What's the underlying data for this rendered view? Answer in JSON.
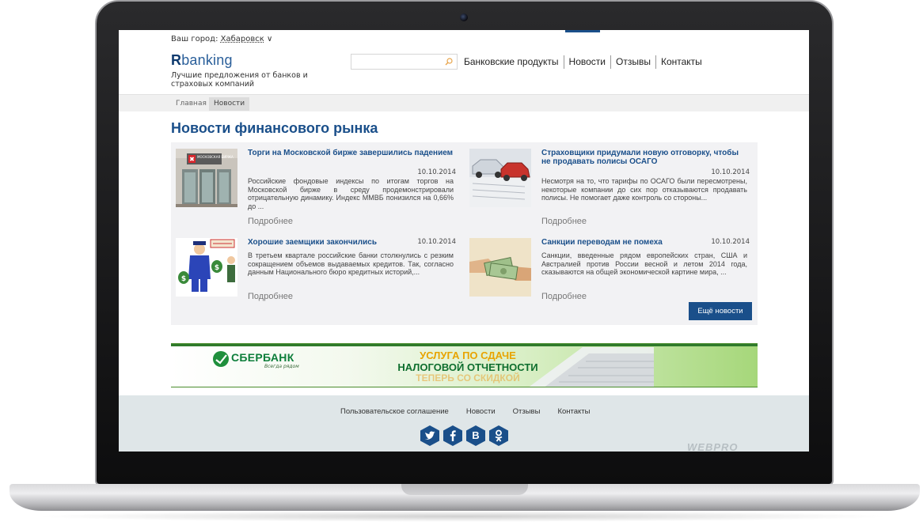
{
  "header": {
    "city_label": "Ваш город:",
    "city_name": "Хабаровск",
    "logo_r": "R",
    "logo_banking": "banking",
    "slogan": "Лучшие предложения от банков и страховых компаний",
    "search_placeholder": ""
  },
  "nav": {
    "items": [
      {
        "label": "Банковские продукты"
      },
      {
        "label": "Новости"
      },
      {
        "label": "Отзывы"
      },
      {
        "label": "Контакты"
      }
    ]
  },
  "breadcrumb": {
    "home": "Главная",
    "current": "Новости"
  },
  "main": {
    "title": "Новости финансового рынка",
    "more_label": "Подробнее",
    "more_news_button": "Ещё новости",
    "news": [
      {
        "title": "Торги на Московской бирже завершились падением",
        "date": "10.10.2014",
        "text": "Российские фондовые индексы по итогам торгов на Московской бирже в среду продемонстрировали отрицательную динамику. Индекс ММВБ понизился на 0,66% до ..."
      },
      {
        "title": "Страховщики придумали новую отговорку, чтобы не продавать полисы ОСАГО",
        "date": "10.10.2014",
        "text": "Несмотря на то, что тарифы по ОСАГО были пересмотрены, некоторые компании до сих пор отказываются продавать полисы. Не помогает даже контроль со стороны..."
      },
      {
        "title": "Хорошие заемщики закончились",
        "date": "10.10.2014",
        "text": "В третьем квартале российские банки столкнулись с резким сокращением объемов выдаваемых кредитов. Так, согласно данным Национального бюро кредитных историй,..."
      },
      {
        "title": "Санкции переводам не помеха",
        "date": "10.10.2014",
        "text": "Санкции, введенные рядом европейских стран, США и Австралией против России весной и летом 2014 года, сказываются на общей экономической картине мира, ..."
      }
    ],
    "thumb_sign": "МОСКОВСКАЯ БИРЖА"
  },
  "banner": {
    "brand": "СБЕРБАНК",
    "tagline": "Всегда рядом",
    "line1": "УСЛУГА ПО СДАЧЕ",
    "line2": "НАЛОГОВОЙ ОТЧЕТНОСТИ",
    "line3": "ТЕПЕРЬ СО СКИДКОЙ"
  },
  "footer": {
    "links": [
      {
        "label": "Пользовательское соглашение"
      },
      {
        "label": "Новости"
      },
      {
        "label": "Отзывы"
      },
      {
        "label": "Контакты"
      }
    ],
    "socials": [
      {
        "icon": "twitter-icon",
        "color": "#1a4f8a"
      },
      {
        "icon": "facebook-icon",
        "color": "#1a4f8a"
      },
      {
        "icon": "vk-icon",
        "color": "#1a4f8a",
        "glyph": "B"
      },
      {
        "icon": "odnoklassniki-icon",
        "color": "#1a4f8a"
      }
    ],
    "watermark": "WEBPRO"
  },
  "colors": {
    "brand_blue": "#1a4f8a",
    "sber_green": "#0d7e3a",
    "footer_bg": "#dfe6e8"
  }
}
